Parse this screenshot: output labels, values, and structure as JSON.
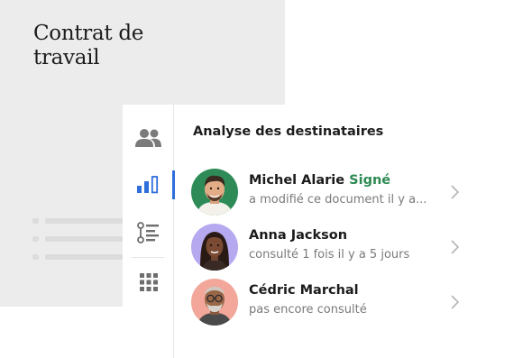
{
  "document": {
    "title": "Contrat de travail"
  },
  "panel": {
    "title": "Analyse des destinataires",
    "nav": [
      {
        "icon": "people-icon"
      },
      {
        "icon": "analytics-bar-icon",
        "active": true
      },
      {
        "icon": "list-icon"
      },
      {
        "icon": "grid-icon"
      }
    ]
  },
  "recipients": [
    {
      "name": "Michel Alarie",
      "status": "Signé",
      "detail": "a modifié ce document il y a...",
      "avatar_bg": "#2e8b57"
    },
    {
      "name": "Anna Jackson",
      "status": "",
      "detail": "consulté 1 fois il y a 5 jours",
      "avatar_bg": "#b7a9f0"
    },
    {
      "name": "Cédric Marchal",
      "status": "",
      "detail": "pas encore consulté",
      "avatar_bg": "#f2a79a"
    }
  ],
  "colors": {
    "accent": "#2f6fdb",
    "signed": "#2e8a52"
  }
}
